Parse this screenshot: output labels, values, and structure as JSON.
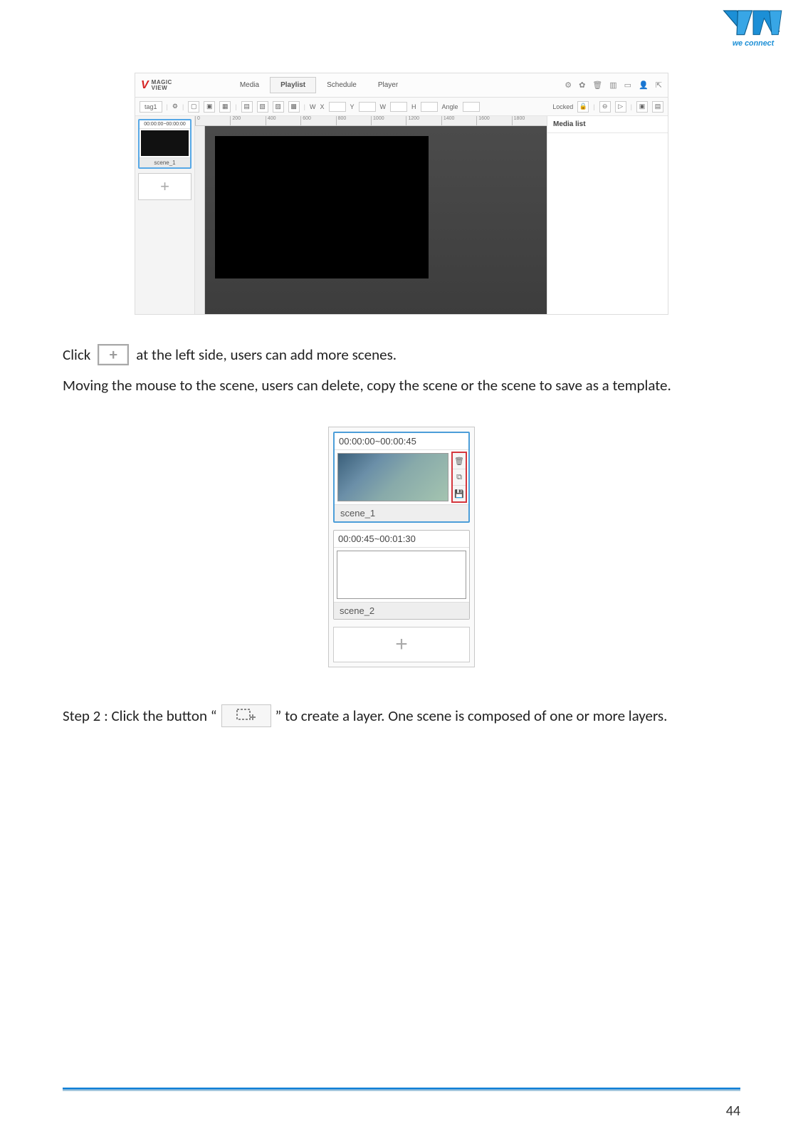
{
  "logo": {
    "brand": "VIA",
    "tagline": "we connect"
  },
  "software": {
    "logoMain": "MAGIC",
    "logoSub": "VIEW",
    "tabs": [
      "Media",
      "Playlist",
      "Schedule",
      "Player"
    ],
    "activeTab": "Playlist",
    "topIcons": [
      "settings-icon",
      "gear-icon",
      "trash-icon",
      "chart-icon",
      "screen-icon",
      "user-icon",
      "export-icon"
    ],
    "row2": {
      "tag": "tag1",
      "toolIcons": [
        "gear-icon",
        "crop-icon",
        "crop-plus-icon",
        "crop-fit-icon"
      ],
      "fieldLabels": [
        "W",
        "X",
        "Y",
        "W",
        "H"
      ],
      "angleLabel": "Angle",
      "lockedLabel": "Locked",
      "rightIcons": [
        "lock-icon",
        "zoom-out-icon",
        "zoom-in-icon",
        "copy-icon",
        "paste-icon"
      ]
    },
    "canvasTicks": [
      "0",
      "200",
      "400",
      "600",
      "800",
      "1000",
      "1200",
      "1400",
      "1600",
      "1800"
    ],
    "scene": {
      "time": "00:00:00~00:00:00",
      "label": "scene_1"
    },
    "mediaList": "Media list"
  },
  "para1a": "Click",
  "para1b": "at the left side, users can add more scenes.",
  "para1c": "Moving the mouse to the scene, users can delete, copy the scene or the scene to save as a template.",
  "scenePanel": {
    "items": [
      {
        "time": "00:00:00~00:00:45",
        "label": "scene_1",
        "selected": true,
        "showButtons": true
      },
      {
        "time": "00:00:45~00:01:30",
        "label": "scene_2",
        "selected": false,
        "showButtons": false
      }
    ],
    "btnIcons": [
      "trash-icon",
      "copy-icon",
      "save-template-icon"
    ]
  },
  "para2a": "Step 2 : Click the button “",
  "para2b": "” to create a layer. One scene is composed of one or more layers.",
  "pageNumber": "44"
}
